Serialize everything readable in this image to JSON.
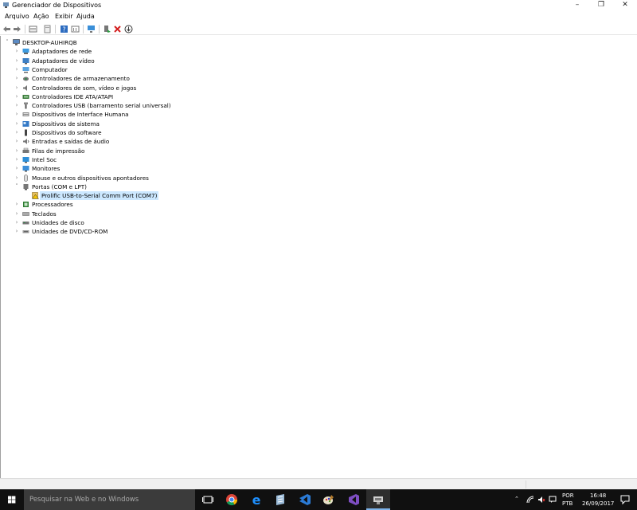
{
  "window": {
    "title": "Gerenciador de Dispositivos",
    "controls": {
      "minimize": "–",
      "restore": "❐",
      "close": "✕"
    }
  },
  "menu": [
    "Arquivo",
    "Ação",
    "Exibir",
    "Ajuda"
  ],
  "toolbar_icons": [
    "back-icon",
    "forward-icon",
    "properties-view-icon",
    "properties-icon",
    "help-icon",
    "details-icon",
    "monitor-icon",
    "enable-device-icon",
    "uninstall-icon",
    "update-driver-icon"
  ],
  "tree": {
    "root": "DESKTOP-AUHIRQB",
    "categories": [
      {
        "label": "Adaptadores de rede",
        "icon": "network-adapter-icon",
        "expanded": false
      },
      {
        "label": "Adaptadores de vídeo",
        "icon": "display-adapter-icon",
        "expanded": false
      },
      {
        "label": "Computador",
        "icon": "computer-icon",
        "expanded": false
      },
      {
        "label": "Controladores de armazenamento",
        "icon": "storage-controller-icon",
        "expanded": false
      },
      {
        "label": "Controladores de som, vídeo e jogos",
        "icon": "sound-icon",
        "expanded": false
      },
      {
        "label": "Controladores IDE ATA/ATAPI",
        "icon": "ide-icon",
        "expanded": false
      },
      {
        "label": "Controladores USB (barramento serial universal)",
        "icon": "usb-icon",
        "expanded": false
      },
      {
        "label": "Dispositivos de Interface Humana",
        "icon": "hid-icon",
        "expanded": false
      },
      {
        "label": "Dispositivos de sistema",
        "icon": "system-device-icon",
        "expanded": false
      },
      {
        "label": "Dispositivos do software",
        "icon": "software-device-icon",
        "expanded": false
      },
      {
        "label": "Entradas e saídas de áudio",
        "icon": "audio-io-icon",
        "expanded": false
      },
      {
        "label": "Filas de impressão",
        "icon": "printer-icon",
        "expanded": false
      },
      {
        "label": "Intel Soc",
        "icon": "intel-soc-icon",
        "expanded": false
      },
      {
        "label": "Monitores",
        "icon": "monitor-icon",
        "expanded": false
      },
      {
        "label": "Mouse e outros dispositivos apontadores",
        "icon": "mouse-icon",
        "expanded": false
      },
      {
        "label": "Portas (COM e LPT)",
        "icon": "port-icon",
        "expanded": true,
        "children": [
          {
            "label": "Prolific USB-to-Serial Comm Port (COM7)",
            "icon": "warning-port-icon",
            "selected": true
          }
        ]
      },
      {
        "label": "Processadores",
        "icon": "processor-icon",
        "expanded": false
      },
      {
        "label": "Teclados",
        "icon": "keyboard-icon",
        "expanded": false
      },
      {
        "label": "Unidades de disco",
        "icon": "disk-drive-icon",
        "expanded": false
      },
      {
        "label": "Unidades de DVD/CD-ROM",
        "icon": "dvd-icon",
        "expanded": false
      }
    ]
  },
  "taskbar": {
    "search_placeholder": "Pesquisar na Web e no Windows",
    "apps": [
      "task-view-icon",
      "chrome-icon",
      "edge-icon",
      "notepad-icon",
      "vscode-icon",
      "paint-icon",
      "visual-studio-icon",
      "device-manager-icon"
    ],
    "tray": {
      "lang_top": "POR",
      "lang_bottom": "PTB",
      "time": "16:48",
      "date": "26/09/2017"
    }
  },
  "colors": {
    "selection": "#cce8ff",
    "taskbar": "#101010",
    "search_box": "#3b3b3b",
    "accent": "#7eb4ea"
  }
}
